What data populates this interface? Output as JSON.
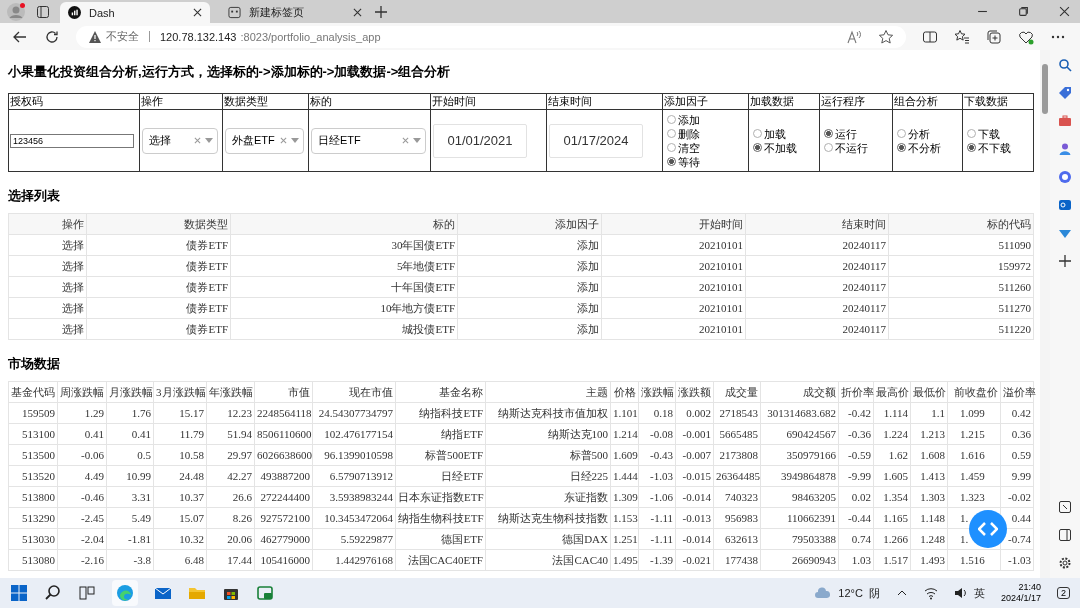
{
  "browser": {
    "tabs": [
      {
        "title": "Dash",
        "selected": true
      },
      {
        "title": "新建标签页",
        "selected": false
      }
    ],
    "address": {
      "security": "不安全",
      "host": "120.78.132.143",
      "path": ":8023/portfolio_analysis_app"
    }
  },
  "page_title": "小果量化投资组合分析,运行方式，选择标的->添加标的->加载数据->组合分析",
  "form": {
    "cells": [
      {
        "header": "授权码",
        "kind": "input",
        "value": "123456"
      },
      {
        "header": "操作",
        "kind": "select",
        "value": "选择"
      },
      {
        "header": "数据类型",
        "kind": "select",
        "value": "外盘ETF"
      },
      {
        "header": "标的",
        "kind": "select",
        "value": "日经ETF"
      },
      {
        "header": "开始时间",
        "kind": "date",
        "value": "01/01/2021"
      },
      {
        "header": "结束时间",
        "kind": "date",
        "value": "01/17/2024"
      },
      {
        "header": "添加因子",
        "kind": "radio",
        "options": [
          {
            "label": "添加",
            "selected": false
          },
          {
            "label": "删除",
            "selected": false
          },
          {
            "label": "清空",
            "selected": false
          },
          {
            "label": "等待",
            "selected": true
          }
        ]
      },
      {
        "header": "加载数据",
        "kind": "radio",
        "options": [
          {
            "label": "加载",
            "selected": false
          },
          {
            "label": "不加载",
            "selected": true
          }
        ]
      },
      {
        "header": "运行程序",
        "kind": "radio",
        "options": [
          {
            "label": "运行",
            "selected": true
          },
          {
            "label": "不运行",
            "selected": false
          }
        ]
      },
      {
        "header": "组合分析",
        "kind": "radio",
        "options": [
          {
            "label": "分析",
            "selected": false
          },
          {
            "label": "不分析",
            "selected": true
          }
        ]
      },
      {
        "header": "下载数据",
        "kind": "radio",
        "options": [
          {
            "label": "下载",
            "selected": false
          },
          {
            "label": "不下载",
            "selected": true
          }
        ]
      }
    ]
  },
  "selection_list": {
    "title": "选择列表",
    "columns": [
      "操作",
      "数据类型",
      "标的",
      "添加因子",
      "开始时间",
      "结束时间",
      "标的代码"
    ],
    "rows": [
      [
        "选择",
        "债券ETF",
        "30年国债ETF",
        "添加",
        "20210101",
        "20240117",
        "511090"
      ],
      [
        "选择",
        "债券ETF",
        "5年地债ETF",
        "添加",
        "20210101",
        "20240117",
        "159972"
      ],
      [
        "选择",
        "债券ETF",
        "十年国债ETF",
        "添加",
        "20210101",
        "20240117",
        "511260"
      ],
      [
        "选择",
        "债券ETF",
        "10年地方债ETF",
        "添加",
        "20210101",
        "20240117",
        "511270"
      ],
      [
        "选择",
        "债券ETF",
        "城投债ETF",
        "添加",
        "20210101",
        "20240117",
        "511220"
      ]
    ]
  },
  "market_data": {
    "title": "市场数据",
    "columns": [
      "基金代码",
      "周涨跌幅",
      "月涨跌幅",
      "3月涨跌幅",
      "年涨跌幅",
      "市值",
      "现在市值",
      "基金名称",
      "主题",
      "价格",
      "涨跌幅",
      "涨跌额",
      "成交量",
      "成交额",
      "折价率",
      "最高价",
      "最低价",
      "前收盘价",
      "溢价率"
    ],
    "rows": [
      [
        "159509",
        "1.29",
        "1.76",
        "15.17",
        "12.23",
        "2248564118",
        "24.54307734797",
        "纳指科技ETF",
        "纳斯达克科技市值加权",
        "1.101",
        "0.18",
        "0.002",
        "2718543",
        "301314683.682",
        "-0.42",
        "1.114",
        "1.1",
        "1.099",
        "0.42"
      ],
      [
        "513100",
        "0.41",
        "0.41",
        "11.79",
        "51.94",
        "8506110600",
        "102.476177154",
        "纳指ETF",
        "纳斯达克100",
        "1.214",
        "-0.08",
        "-0.001",
        "5665485",
        "690424567",
        "-0.36",
        "1.224",
        "1.213",
        "1.215",
        "0.36"
      ],
      [
        "513500",
        "-0.06",
        "0.5",
        "10.58",
        "29.97",
        "6026638600",
        "96.1399010598",
        "标普500ETF",
        "标普500",
        "1.609",
        "-0.43",
        "-0.007",
        "2173808",
        "350979166",
        "-0.59",
        "1.62",
        "1.608",
        "1.616",
        "0.59"
      ],
      [
        "513520",
        "4.49",
        "10.99",
        "24.48",
        "42.27",
        "493887200",
        "6.5790713912",
        "日经ETF",
        "日经225",
        "1.444",
        "-1.03",
        "-0.015",
        "26364485",
        "3949864878",
        "-9.99",
        "1.605",
        "1.413",
        "1.459",
        "9.99"
      ],
      [
        "513800",
        "-0.46",
        "3.31",
        "10.37",
        "26.6",
        "272244400",
        "3.5938983244",
        "日本东证指数ETF",
        "东证指数",
        "1.309",
        "-1.06",
        "-0.014",
        "740323",
        "98463205",
        "0.02",
        "1.354",
        "1.303",
        "1.323",
        "-0.02"
      ],
      [
        "513290",
        "-2.45",
        "5.49",
        "15.07",
        "8.26",
        "927572100",
        "10.3453472064",
        "纳指生物科技ETF",
        "纳斯达克生物科技指数",
        "1.153",
        "-1.11",
        "-0.013",
        "956983",
        "110662391",
        "-0.44",
        "1.165",
        "1.148",
        "1.",
        "0.44"
      ],
      [
        "513030",
        "-2.04",
        "-1.81",
        "10.32",
        "20.06",
        "462779000",
        "5.59229877",
        "德国ETF",
        "德国DAX",
        "1.251",
        "-1.11",
        "-0.014",
        "632613",
        "79503388",
        "0.74",
        "1.266",
        "1.248",
        "1.",
        "-0.74"
      ],
      [
        "513080",
        "-2.16",
        "-3.8",
        "6.48",
        "17.44",
        "105416000",
        "1.442976168",
        "法国CAC40ETF",
        "法国CAC40",
        "1.495",
        "-1.39",
        "-0.021",
        "177438",
        "26690943",
        "1.03",
        "1.517",
        "1.493",
        "1.516",
        "-1.03"
      ]
    ]
  },
  "taskbar": {
    "weather": {
      "temperature": "12°C",
      "condition": "阴"
    },
    "input_method": "英",
    "time": "21:40",
    "date": "2024/1/17",
    "notifications": "2"
  }
}
